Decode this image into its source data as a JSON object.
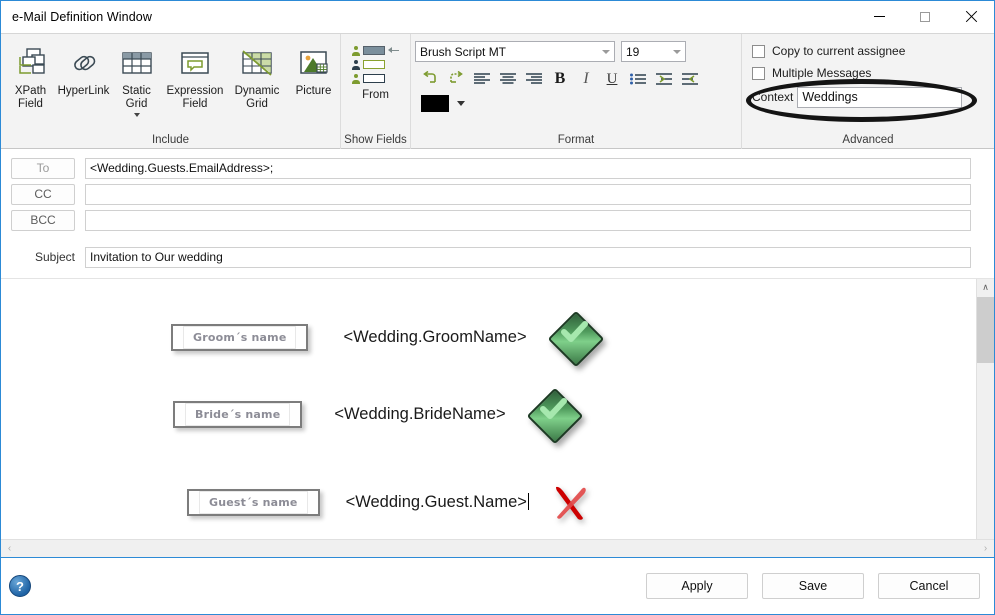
{
  "window": {
    "title": "e-Mail Definition Window",
    "controls": {
      "minimize": "—",
      "maximize": "□",
      "close": "✕"
    }
  },
  "ribbon": {
    "groups": [
      {
        "label": "Include",
        "buttons": [
          {
            "name": "xpath-field",
            "label_line1": "XPath",
            "label_line2": "Field",
            "icon": "xpath-field-icon",
            "has_caret": false
          },
          {
            "name": "hyperlink",
            "label_line1": "HyperLink",
            "label_line2": "",
            "icon": "hyperlink-icon",
            "has_caret": false
          },
          {
            "name": "static-grid",
            "label_line1": "Static",
            "label_line2": "Grid",
            "icon": "static-grid-icon",
            "has_caret": true
          },
          {
            "name": "expression-field",
            "label_line1": "Expression",
            "label_line2": "Field",
            "icon": "expression-field-icon",
            "has_caret": false
          },
          {
            "name": "dynamic-grid",
            "label_line1": "Dynamic",
            "label_line2": "Grid",
            "icon": "dynamic-grid-icon",
            "has_caret": false
          },
          {
            "name": "picture",
            "label_line1": "Picture",
            "label_line2": "",
            "icon": "picture-icon",
            "has_caret": false
          }
        ]
      },
      {
        "label": "Show Fields",
        "from_button": "From"
      },
      {
        "label": "Format",
        "font_name": "Brush Script MT",
        "font_size": "19",
        "tools": [
          {
            "name": "undo-button",
            "icon": "undo-icon"
          },
          {
            "name": "redo-button",
            "icon": "redo-icon"
          },
          {
            "name": "align-left-button",
            "icon": "align-left-icon"
          },
          {
            "name": "align-center-button",
            "icon": "align-center-icon"
          },
          {
            "name": "align-right-button",
            "icon": "align-right-icon"
          },
          {
            "name": "bold-button",
            "icon": "bold-icon",
            "glyph": "B"
          },
          {
            "name": "italic-button",
            "icon": "italic-icon",
            "glyph": "I"
          },
          {
            "name": "underline-button",
            "icon": "underline-icon",
            "glyph": "U"
          },
          {
            "name": "bullet-list-button",
            "icon": "bullet-list-icon"
          },
          {
            "name": "increase-indent-button",
            "icon": "increase-indent-icon"
          },
          {
            "name": "decrease-indent-button",
            "icon": "decrease-indent-icon"
          }
        ],
        "text_color": "#000000"
      },
      {
        "label": "Advanced",
        "checkboxes": [
          {
            "name": "copy-to-current-assignee",
            "label": "Copy to current assignee",
            "checked": false
          },
          {
            "name": "multiple-messages",
            "label": "Multiple Messages",
            "checked": false
          }
        ],
        "context_label": "Context",
        "context_value": "Weddings",
        "highlight_color": "#141414"
      }
    ]
  },
  "header_fields": {
    "rows": [
      {
        "name": "to",
        "button": "To",
        "value": "<Wedding.Guests.EmailAddress>;",
        "dim": true
      },
      {
        "name": "cc",
        "button": "CC",
        "value": "",
        "dim": false
      },
      {
        "name": "bcc",
        "button": "BCC",
        "value": "",
        "dim": false
      }
    ],
    "subject_label": "Subject",
    "subject_value": "Invitation to Our wedding"
  },
  "body": {
    "rows": [
      {
        "name": "groom-row",
        "tag": "Groom´s name",
        "expression": "<Wedding.GroomName>",
        "status_icon": "green-check-diamond-icon",
        "status": "valid",
        "caret": false
      },
      {
        "name": "bride-row",
        "tag": "Bride´s name",
        "expression": "<Wedding.BrideName>",
        "status_icon": "green-check-diamond-icon",
        "status": "valid",
        "caret": false
      },
      {
        "name": "guest-row",
        "tag": "Guest´s name",
        "expression": "<Wedding.Guest.Name>",
        "status_icon": "red-x-icon",
        "status": "invalid",
        "caret": true
      }
    ]
  },
  "scrollbars": {
    "vertical": {
      "up": "∧",
      "down": "∨"
    },
    "horizontal": {
      "left": "‹",
      "right": "›"
    }
  },
  "footer": {
    "help": "?",
    "buttons": [
      {
        "name": "apply-button",
        "label": "Apply"
      },
      {
        "name": "save-button",
        "label": "Save"
      },
      {
        "name": "cancel-button",
        "label": "Cancel"
      }
    ]
  }
}
